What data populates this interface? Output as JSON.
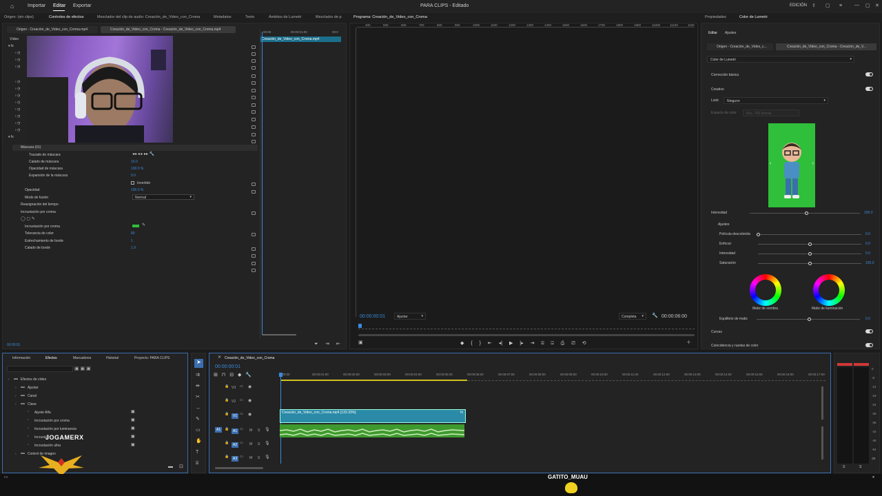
{
  "topbar": {
    "import": "Importar",
    "edit": "Editar",
    "export": "Exportar",
    "project_title": "PARA CLIPS - Editado",
    "workspace": "EDICIÓN"
  },
  "tabs": {
    "origin": "Origen: (sin clips)",
    "effect_controls": "Controles de efectos",
    "audio_mixer": "Mezclador del clip de audio: Creación_de_Video_con_Croma",
    "metadata": "Metadatos",
    "text": "Texto",
    "lumetri_scopes": "Ámbitos de Lumetri",
    "mixer_short": "Mezclador de p",
    "program": "Programa: Creación_de_Video_con_Croma",
    "properties": "Propiedades",
    "lumetri_color": "Color de Lumetri"
  },
  "effect_controls": {
    "source_tab": "Origen - Creación_de_Video_con_Croma.mp4",
    "seq_tab": "Creación_de_Video_con_Croma - Creación_de_Video_con_Croma.mp4",
    "video_label": "Vídeo",
    "time_start": "00:00",
    "time_mid": "00:00:01:00",
    "time_end": "00:0",
    "clip_name": "Creación_de_Video_con_Croma.mp4",
    "rows": [
      {
        "label": "Máscara (01)",
        "value": ""
      },
      {
        "label": "Trazado de máscara",
        "value": ""
      },
      {
        "label": "Calado de máscara",
        "value": "10.0"
      },
      {
        "label": "Opacidad de máscara",
        "value": "100.0 %"
      },
      {
        "label": "Expansión de la máscara",
        "value": "0.0"
      },
      {
        "label": "Invertido",
        "value": ""
      },
      {
        "label": "Opacidad",
        "value": "100.0 %"
      },
      {
        "label": "Modo de fusión",
        "value": "Normal"
      },
      {
        "label": "Reasignación del tiempo",
        "value": ""
      },
      {
        "label": "Incrustación por croma",
        "value": ""
      },
      {
        "label": "Incrustación por croma",
        "value": ""
      },
      {
        "label": "Tolerancia de color",
        "value": "80"
      },
      {
        "label": "Estrechamiento de borde",
        "value": "1"
      },
      {
        "label": "Calado de borde",
        "value": "1.9"
      }
    ],
    "timecode": "00:00:01"
  },
  "program": {
    "ruler": [
      "400",
      "500",
      "600",
      "700",
      "800",
      "900",
      "1000",
      "1100",
      "1200",
      "1300",
      "1400",
      "1500",
      "1600",
      "1700",
      "1800",
      "1900",
      "11000",
      "11100",
      "1100"
    ],
    "timecode": "00:00:00:01",
    "fit": "Ajustar",
    "quality": "Completa",
    "duration": "00:00:06:00"
  },
  "lumetri": {
    "edit_tab": "Editar",
    "settings_tab": "Ajustes",
    "source_tab": "Origen - Creación_de_Video_c...",
    "seq_tab": "Creación_de_Video_con_Croma - Creación_de_V...",
    "effect": "Color de Lumetri",
    "basic": "Corrección básica",
    "creative": "Creativo",
    "look_label": "Look",
    "look_value": "Ninguno",
    "colorspace_label": "Espacio de color",
    "colorspace_value": "Rec. 709 (lineal)",
    "intensity_label": "Intensidad",
    "intensity_value": "100.0",
    "adjustments": "Ajustes",
    "sliders": [
      {
        "label": "Película descolorida",
        "value": "0.0",
        "pos": 0
      },
      {
        "label": "Enfocar",
        "value": "0.0",
        "pos": 0.5
      },
      {
        "label": "Intensidad",
        "value": "0.0",
        "pos": 0.5
      },
      {
        "label": "Saturación",
        "value": "100.0",
        "pos": 0.5
      }
    ],
    "shadow_tint": "Matiz de sombra",
    "highlight_tint": "Matiz de iluminación",
    "tint_balance_label": "Equilibrio de matiz",
    "tint_balance_value": "0.0",
    "curves": "Curvas",
    "color_match": "Coincidencia y ruedas de color"
  },
  "project_panel": {
    "tabs": [
      "Información",
      "Efectos",
      "Marcadores",
      "Historial",
      "Proyecto: PARA CLIPS"
    ],
    "items": [
      {
        "label": "Efectos de vídeo",
        "indent": 0
      },
      {
        "label": "Ajustar",
        "indent": 1
      },
      {
        "label": "Canal",
        "indent": 1
      },
      {
        "label": "Clave",
        "indent": 1
      },
      {
        "label": "Ajuste Alfa",
        "indent": 2
      },
      {
        "label": "Incrustación por croma",
        "indent": 2
      },
      {
        "label": "Incrustación por luminancia",
        "indent": 2
      },
      {
        "label": "Incrustac",
        "indent": 2
      },
      {
        "label": "Incrustación ultra",
        "indent": 2
      },
      {
        "label": "Control de imagen",
        "indent": 1
      }
    ],
    "watermark": "JOGAMERX"
  },
  "timeline": {
    "seq_tab": "Creación_de_Video_con_Croma",
    "timecode": "00:00:00:01",
    "ruler": [
      ":00:00",
      "00:00:01:00",
      "00:00:02:00",
      "00:00:03:00",
      "00:00:04:00",
      "00:00:05:00",
      "00:00:06:00",
      "00:00:07:00",
      "00:00:08:00",
      "00:00:09:00",
      "00:00:10:00",
      "00:00:11:00",
      "00:00:12:00",
      "00:00:13:00",
      "00:00:14:00",
      "00:00:15:00",
      "00:00:16:00",
      "00:00:17:00"
    ],
    "video_tracks": [
      "V3",
      "V2",
      "V1"
    ],
    "audio_tracks": [
      "A1",
      "A2",
      "A3"
    ],
    "clip_label": "Creación_de_Video_con_Croma.mp4 [133.33%]",
    "meter_labels": [
      "0",
      "-6",
      "-12",
      "-18",
      "-24",
      "-30",
      "-36",
      "-42",
      "-48",
      "-54",
      "dB"
    ]
  },
  "footer_watermark": "GATITO_MUAU",
  "colors": {
    "accent": "#3b8bdc",
    "clip_video": "#2a8aa8",
    "clip_audio": "#3f9a2e",
    "green_screen": "#2fbf3a"
  }
}
